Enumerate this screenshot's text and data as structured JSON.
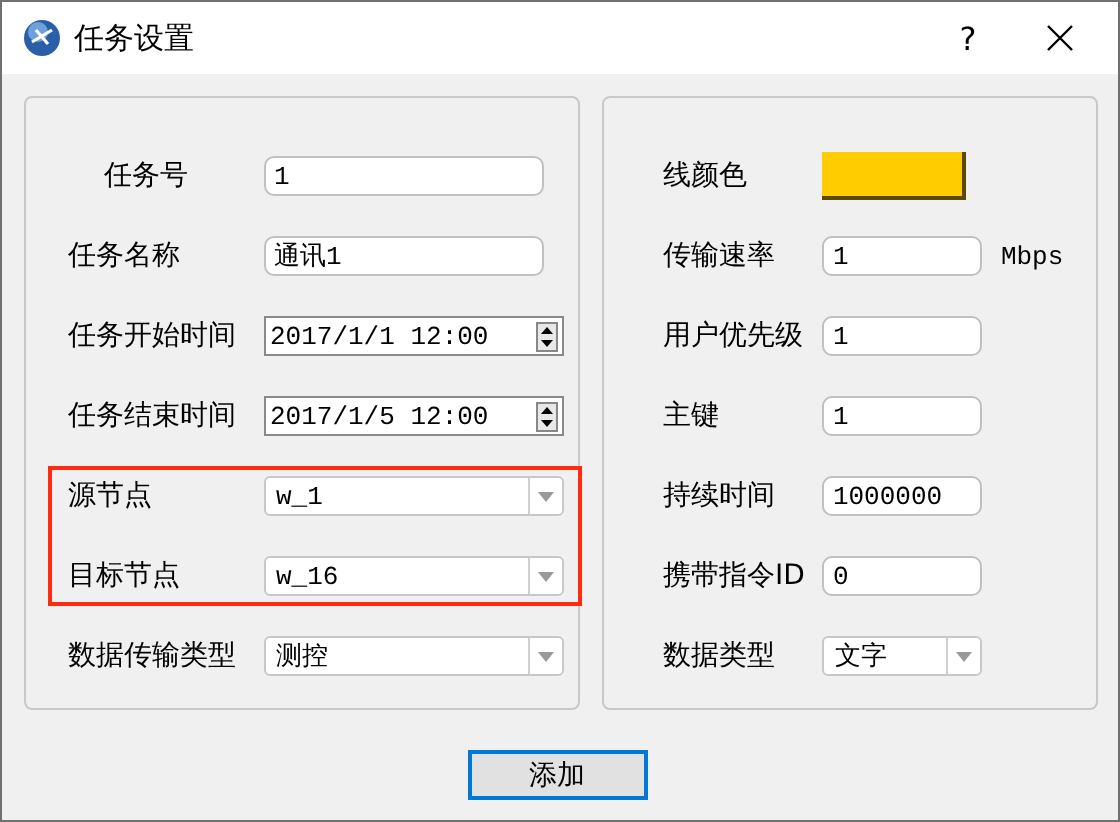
{
  "window": {
    "title": "任务设置",
    "help": "?"
  },
  "left_fields": [
    {
      "label": "任务号",
      "kind": "text",
      "value": "1",
      "highlighted": false
    },
    {
      "label": "任务名称",
      "kind": "text",
      "value": "通讯1",
      "highlighted": false
    },
    {
      "label": "任务开始时间",
      "kind": "spin",
      "value": "2017/1/1 12:00",
      "highlighted": false
    },
    {
      "label": "任务结束时间",
      "kind": "spin",
      "value": "2017/1/5 12:00",
      "highlighted": false
    },
    {
      "label": "源节点",
      "kind": "combo",
      "value": "w_1",
      "highlighted": true
    },
    {
      "label": "目标节点",
      "kind": "combo",
      "value": "w_16",
      "highlighted": true
    },
    {
      "label": "数据传输类型",
      "kind": "combo",
      "value": "测控",
      "highlighted": false
    }
  ],
  "right_fields": [
    {
      "label": "线颜色",
      "kind": "color",
      "color": "#ffcc00"
    },
    {
      "label": "传输速率",
      "kind": "text",
      "value": "1",
      "unit": "Mbps"
    },
    {
      "label": "用户优先级",
      "kind": "text",
      "value": "1"
    },
    {
      "label": "主键",
      "kind": "text",
      "value": "1"
    },
    {
      "label": "持续时间",
      "kind": "text",
      "value": "1000000"
    },
    {
      "label": "携带指令ID",
      "kind": "text",
      "value": "0"
    },
    {
      "label": "数据类型",
      "kind": "combo",
      "value": "文字"
    }
  ],
  "buttons": [
    "添加"
  ]
}
